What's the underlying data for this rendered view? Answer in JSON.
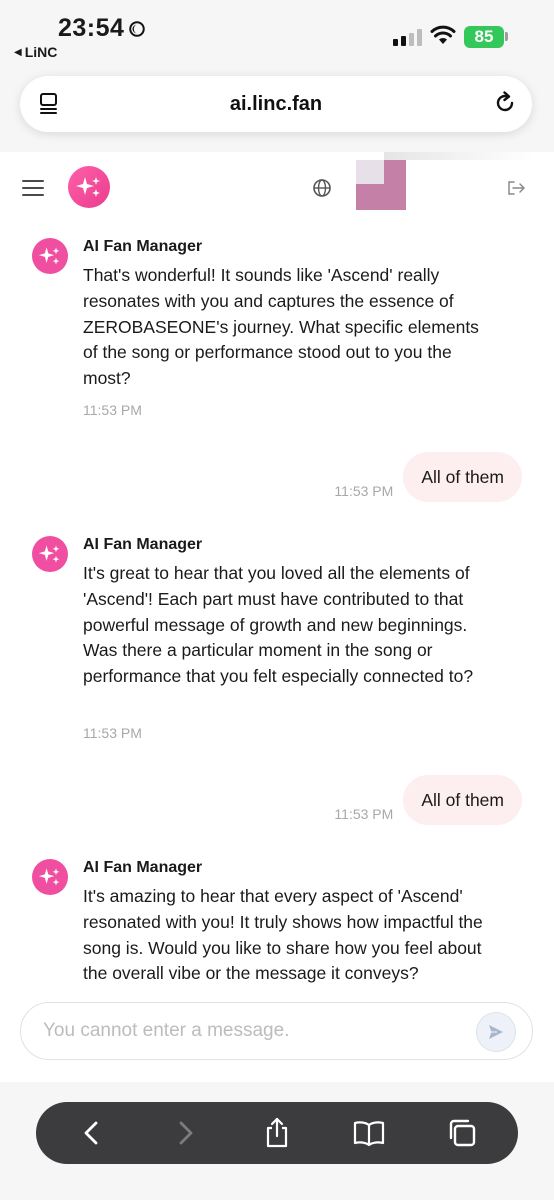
{
  "status_bar": {
    "time": "23:54",
    "back_app": "LiNC",
    "battery": "85"
  },
  "browser": {
    "url": "ai.linc.fan"
  },
  "chat": {
    "messages": [
      {
        "sender": "AI Fan Manager",
        "text": "That's wonderful! It sounds like 'Ascend' really resonates with you and captures the essence of ZEROBASEONE's journey. What specific elements of the song or performance stood out to you the most?",
        "time": "11:53 PM"
      },
      {
        "text": "All of them",
        "time": "11:53 PM"
      },
      {
        "sender": "AI Fan Manager",
        "text": "It's great to hear that you loved all the elements of 'Ascend'! Each part must have contributed to that powerful message of growth and new beginnings. Was there a particular moment in the song or performance that you felt especially connected to?",
        "time": "11:53 PM"
      },
      {
        "text": "All of them",
        "time": "11:53 PM"
      },
      {
        "sender": "AI Fan Manager",
        "text": "It's amazing to hear that every aspect of 'Ascend' resonated with you! It truly shows how impactful the song is. Would you like to share how you feel about the overall vibe or the message it conveys?"
      }
    ],
    "input_placeholder": "You cannot enter a message."
  },
  "colors": {
    "accent_pink": "#f04ea0",
    "user_bubble": "#fdeef0",
    "battery_green": "#34c759",
    "toolbar": "#3c3c3e"
  },
  "icons": [
    "moon-icon",
    "wifi-icon",
    "tabs-icon",
    "reload-icon",
    "menu-icon",
    "sparkle-icon",
    "globe-icon",
    "logout-icon",
    "send-icon",
    "back-icon",
    "forward-icon",
    "share-icon",
    "bookmarks-icon",
    "tabs-overview-icon"
  ]
}
